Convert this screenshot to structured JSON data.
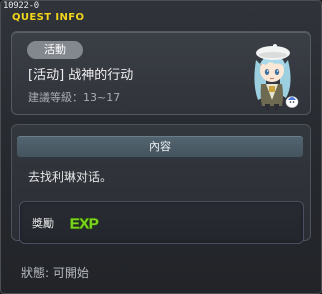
{
  "window": {
    "id_label": "10922-0",
    "title": "QUEST INFO"
  },
  "quest": {
    "category_tag": "活動",
    "name": "[活动] 战神的行动",
    "level_requirement": "建議等級：13~17",
    "npc_icon": "npc-girl-with-beret-icon"
  },
  "content": {
    "header": "內容",
    "description": "去找利琳对话。",
    "reward": {
      "label": "獎勵",
      "icon": "exp-icon",
      "icon_text": "EXP"
    }
  },
  "status": {
    "text": "狀態: 可開始"
  },
  "colors": {
    "title_yellow": "#f2d51a",
    "exp_green": "#7cd61e",
    "panel_bg": "#30343a",
    "header_bar": "#4b5c67"
  }
}
